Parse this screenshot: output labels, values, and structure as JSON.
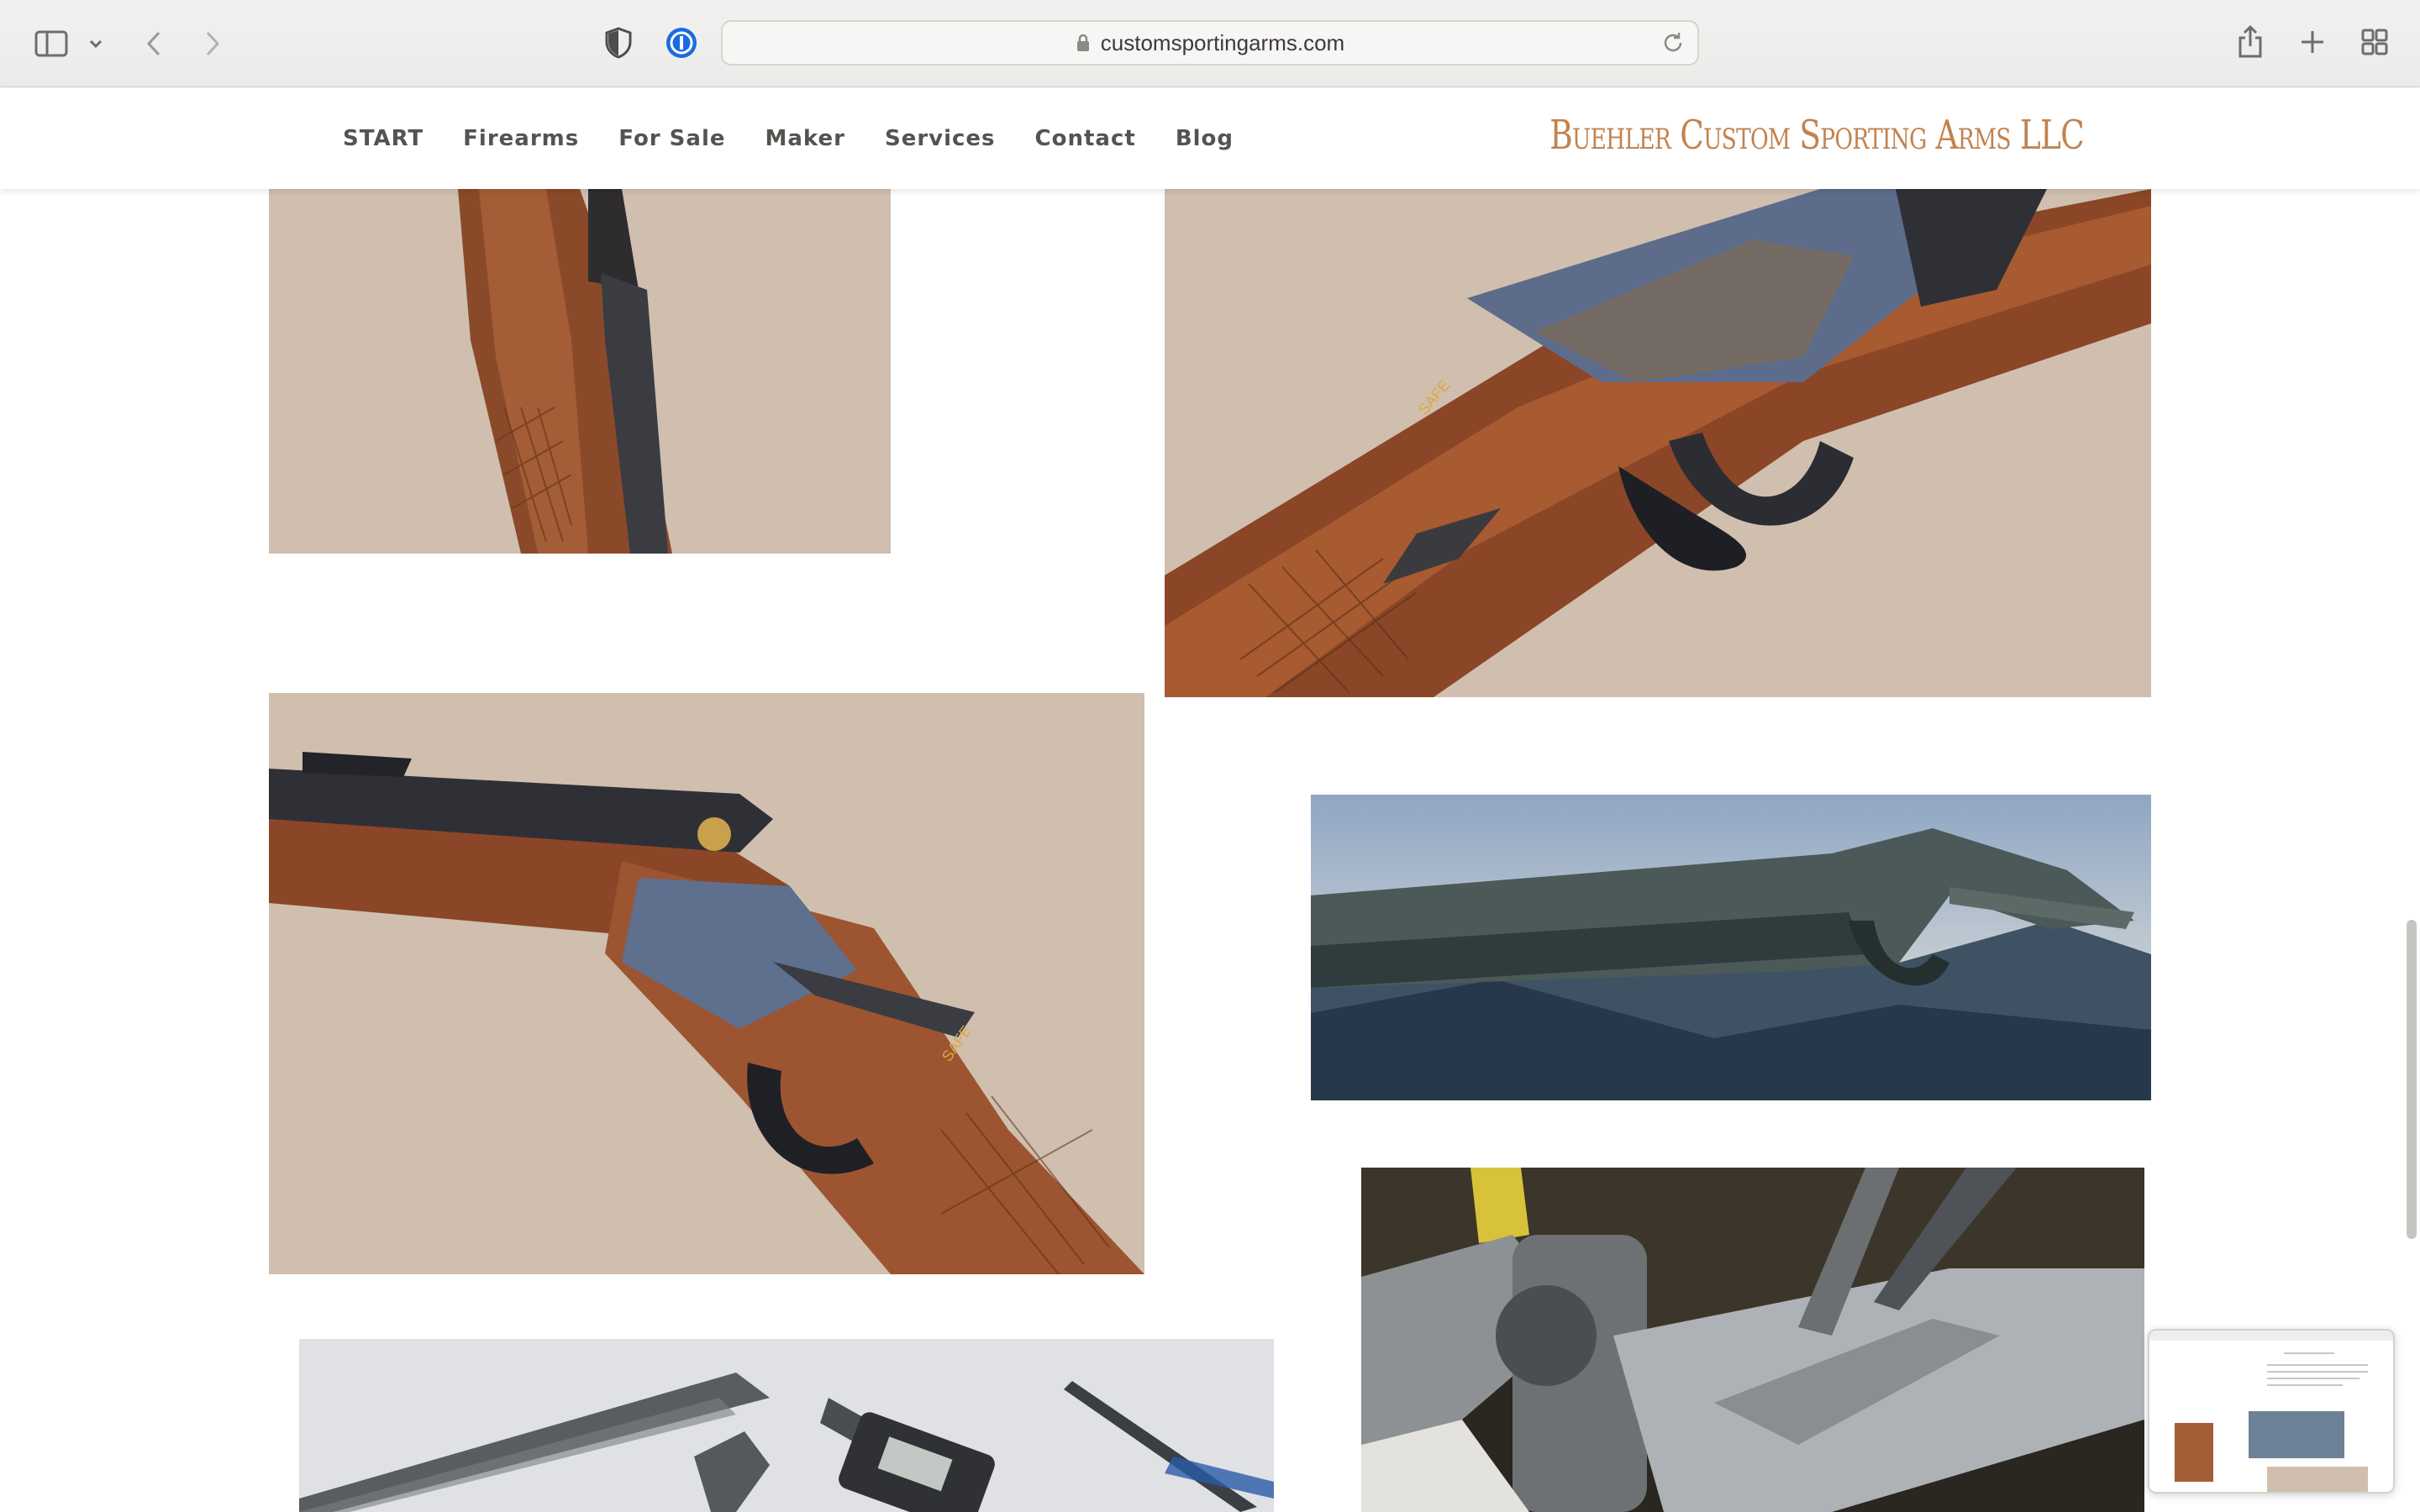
{
  "browser": {
    "url": "customsportingarms.com",
    "icons": [
      "sidebar-icon",
      "chevron-down-icon",
      "back-icon",
      "forward-icon",
      "shield-icon",
      "password-manager-icon",
      "lock-icon",
      "reload-icon",
      "share-icon",
      "new-tab-icon",
      "tab-overview-icon"
    ]
  },
  "site": {
    "brand": "Buehler Custom Sporting Arms LLC",
    "nav": [
      "START",
      "Firearms",
      "For Sale",
      "Maker",
      "Services",
      "Contact",
      "Blog"
    ]
  },
  "colors": {
    "brand": "#c2834f",
    "photo_background": "#d0bfaf",
    "nav_text": "#555350"
  }
}
